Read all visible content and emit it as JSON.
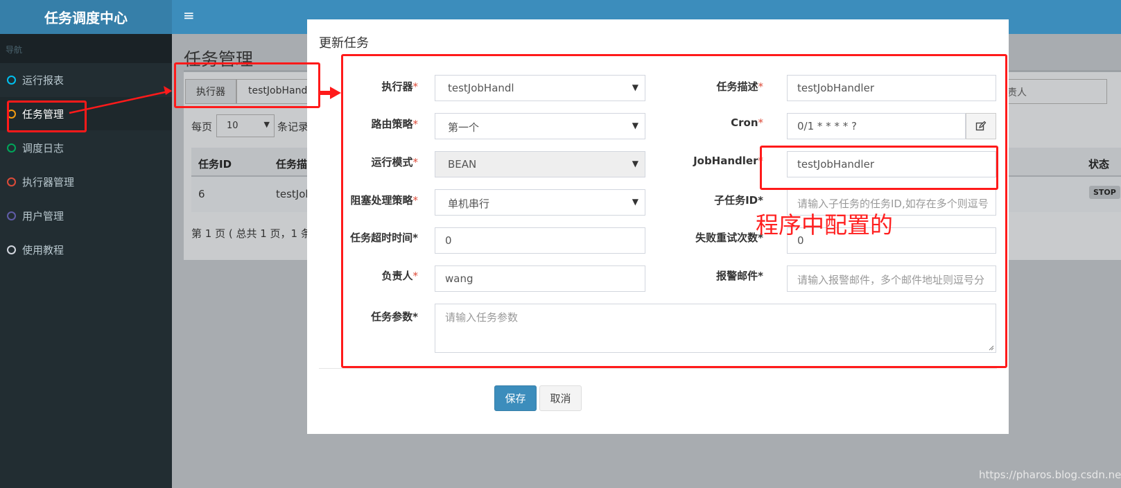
{
  "sidebar": {
    "logo": "任务调度中心",
    "nav_header": "导航",
    "items": [
      {
        "label": "运行报表",
        "dot_color": "#00c0ef"
      },
      {
        "label": "任务管理",
        "dot_color": "#f39c12"
      },
      {
        "label": "调度日志",
        "dot_color": "#00a65a"
      },
      {
        "label": "执行器管理",
        "dot_color": "#dd4b39"
      },
      {
        "label": "用户管理",
        "dot_color": "#605ca8"
      },
      {
        "label": "使用教程",
        "dot_color": "#d2d6de"
      }
    ]
  },
  "header": {
    "menu_icon": "≡"
  },
  "page": {
    "title": "任务管理",
    "filter": {
      "executor_label": "执行器",
      "executor_value": "testJobHand"
    },
    "right_input_value": "责人",
    "per_page_label": "每页",
    "per_page_value": "10",
    "records_label": "条记录",
    "table": {
      "headers": [
        "任务ID",
        "任务描",
        "状态"
      ],
      "row": {
        "id": "6",
        "desc": "testJob",
        "status": "STOP"
      }
    },
    "pagination": "第 1 页 ( 总共 1 页，1 条"
  },
  "modal": {
    "title": "更新任务",
    "left_fields": [
      {
        "label": "执行器",
        "required_mark": "*",
        "value": "testJobHandl",
        "type": "select"
      },
      {
        "label": "路由策略",
        "required_mark": "*",
        "value": "第一个",
        "type": "select"
      },
      {
        "label": "运行模式",
        "required_mark": "*",
        "value": "BEAN",
        "type": "select-disabled"
      },
      {
        "label": "阻塞处理策略",
        "required_mark": "*",
        "value": "单机串行",
        "type": "select"
      },
      {
        "label": "任务超时时间",
        "required_mark": "*",
        "value": "0",
        "type": "input"
      },
      {
        "label": "负责人",
        "required_mark": "*",
        "value": "wang",
        "type": "input"
      }
    ],
    "right_fields": [
      {
        "label": "任务描述",
        "required_mark": "*",
        "value": "testJobHandler",
        "type": "input"
      },
      {
        "label": "Cron",
        "required_mark": "*",
        "value": "0/1 * * * * ?",
        "type": "input-button"
      },
      {
        "label": "JobHandler",
        "required_mark": "*",
        "value": "testJobHandler",
        "type": "input"
      },
      {
        "label": "子任务ID",
        "required_mark": "*",
        "placeholder": "请输入子任务的任务ID,如存在多个则逗号",
        "type": "input"
      },
      {
        "label": "失败重试次数",
        "required_mark": "*",
        "value": "0",
        "type": "input"
      },
      {
        "label": "报警邮件",
        "required_mark": "*",
        "placeholder": "请输入报警邮件，多个邮件地址则逗号分",
        "type": "input"
      }
    ],
    "params": {
      "label": "任务参数",
      "required_mark": "*",
      "placeholder": "请输入任务参数"
    },
    "buttons": {
      "save": "保存",
      "cancel": "取消"
    }
  },
  "annotation": {
    "text": "程序中配置的",
    "color": "#ff1a1a"
  },
  "watermark": "https://pharos.blog.csdn.net"
}
